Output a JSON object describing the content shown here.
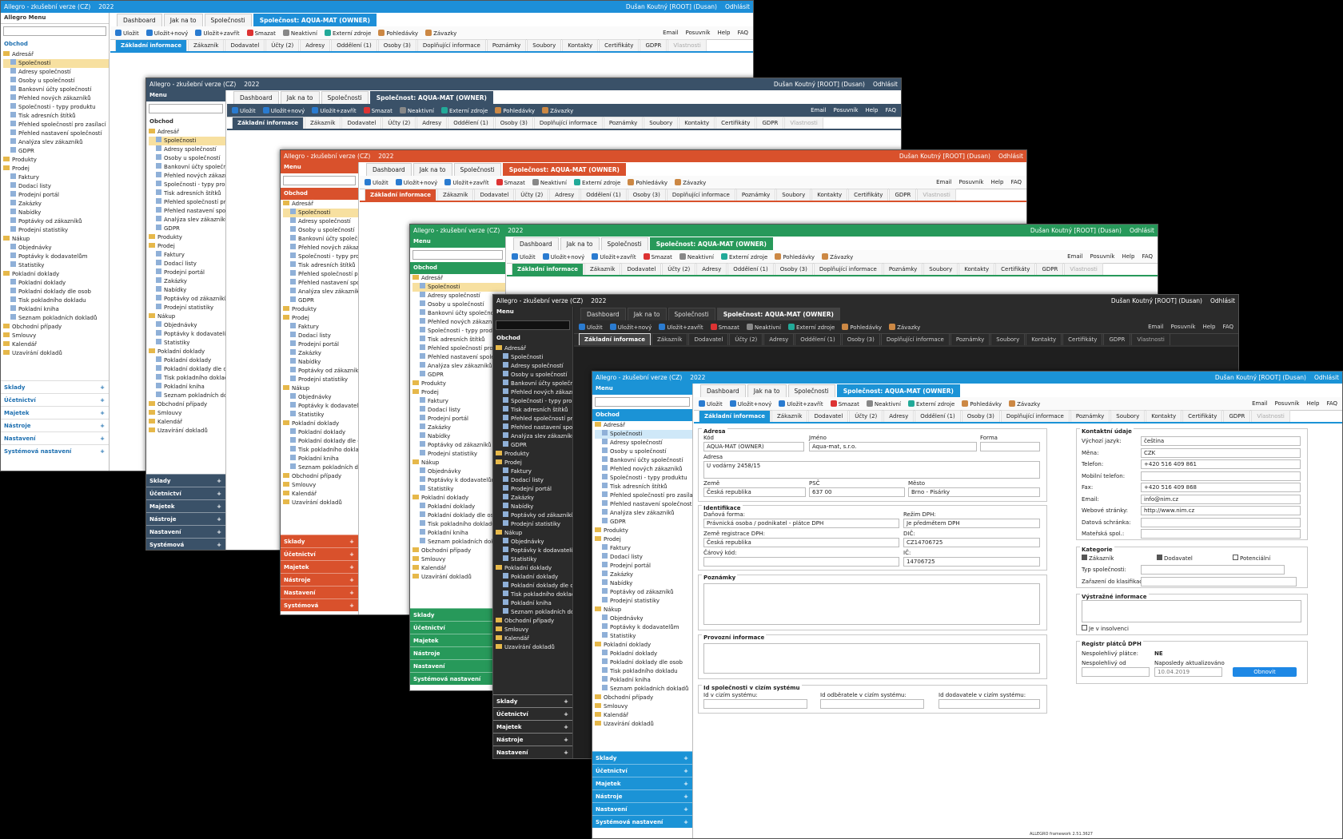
{
  "common": {
    "user": "Dušan Koutný [ROOT] (Dusan)",
    "logout": "Odhlásit",
    "year": "2022",
    "env": "Allegro - zkušební verze (CZ)",
    "menu": "Menu",
    "tabs": [
      "Dashboard",
      "Jak na to",
      "Společnosti",
      "Společnost: AQUA-MAT (OWNER)"
    ],
    "toolbar": [
      "Uložit",
      "Uložit+nový",
      "Uložit+zavřít",
      "Smazat",
      "Neaktivní",
      "Externí zdroje",
      "Pohledávky",
      "Závazky"
    ],
    "toolbar_right": [
      "Email",
      "Posuvník",
      "Help",
      "FAQ"
    ],
    "subtabs": [
      "Základní informace",
      "Zákazník",
      "Dodavatel",
      "Účty (2)",
      "Adresy",
      "Oddělení (1)",
      "Osoby (3)",
      "Doplňující informace",
      "Poznámky",
      "Soubory",
      "Kontakty",
      "Certifikáty",
      "GDPR",
      "Vlastnosti"
    ],
    "section_obchod": "Obchod",
    "tree": [
      "Adresář",
      "Společnosti",
      "Adresy společností",
      "Osoby u společností",
      "Bankovní účty společností",
      "Přehled nových zákazníků",
      "Společnosti - typy produktu",
      "Tisk adresních štítků",
      "Přehled společností pro zasílací",
      "Přehled nastavení společností",
      "Analýza slev zákazníků",
      "GDPR",
      "Produkty",
      "Prodej",
      "Faktury",
      "Dodací listy",
      "Prodejní portál",
      "Zakázky",
      "Nabídky",
      "Poptávky od zákazníků",
      "Prodejní statistiky",
      "Nákup",
      "Objednávky",
      "Poptávky k dodavatelům",
      "Statistiky",
      "Pokladní doklady",
      "Pokladní doklady",
      "Pokladní doklady dle osob",
      "Tisk pokladního dokladu",
      "Pokladní kniha",
      "Seznam pokladních dokladů",
      "Obchodní případy",
      "Smlouvy",
      "Kalendář",
      "Uzavírání dokladů"
    ],
    "bottom_sections": [
      "Sklady",
      "Účetnictví",
      "Majetek",
      "Nástroje",
      "Nastavení",
      "Systémová nastavení"
    ],
    "title_small": "Allegro Menu"
  },
  "form": {
    "adresa": "Adresa",
    "kod_label": "Kód",
    "kod": "AQUA-MAT (OWNER)",
    "jmeno_label": "Jméno",
    "jmeno": "Aqua-mat, s.r.o.",
    "forma_label": "Forma",
    "adresa_label": "Adresa",
    "ulice": "U vodárny 2458/15",
    "zeme_label": "Země",
    "zeme": "Česká republika",
    "psc_label": "PSČ",
    "psc": "637 00",
    "mesto_label": "Město",
    "mesto": "Brno - Pisárky",
    "identifikace": "Identifikace",
    "danova_forma_label": "Daňová forma:",
    "danova_forma": "Právnická osoba / podnikatel - plátce DPH",
    "rezim_label": "Režim DPH:",
    "rezim": "Je předmětem DPH",
    "zeme_reg_label": "Země registrace DPH:",
    "zeme_reg": "Česká republika",
    "dic_label": "DIČ:",
    "dic": "CZ14706725",
    "carovy_label": "Čárový kód:",
    "ic_label": "IČ:",
    "ic": "14706725",
    "poznamky": "Poznámky",
    "provozni": "Provozní informace",
    "id_ciz": "Id společnosti v cizím systému",
    "id_ciz_sys": "Id v cizím systému:",
    "id_odb": "Id odběratele v cizím systému:",
    "id_dod": "Id dodavatele v cizím systému:",
    "kontakt": "Kontaktní údaje",
    "jazyk_label": "Výchozí jazyk:",
    "jazyk": "čeština",
    "mena_label": "Měna:",
    "mena": "CZK",
    "tel_label": "Telefon:",
    "tel": "+420 516 409 861",
    "mob_label": "Mobilní telefon:",
    "fax_label": "Fax:",
    "fax": "+420 516 409 868",
    "email_label": "Email:",
    "email": "info@nim.cz",
    "web_label": "Webové stránky:",
    "web": "http://www.nim.cz",
    "datschr_label": "Datová schránka:",
    "matersk_label": "Mateřská spol.:",
    "kategorie": "Kategorie",
    "zakaznik": "Zákazník",
    "dodavatel": "Dodavatel",
    "potencialni": "Potenciální",
    "typ_label": "Typ společnosti:",
    "zarazeni_label": "Zařazení do klasifikace:",
    "vystrazne": "Výstražné informace",
    "je_v_insolv": "Je v insolvenci",
    "registr": "Registr plátců DPH",
    "nespol_label": "Nespolehlivý plátce:",
    "nespol": "NE",
    "nespol_od_label": "Nespolehlivý od",
    "naposledy_label": "Naposledy aktualizováno",
    "naposledy": "10.04.2019",
    "obnovit": "Obnovit"
  },
  "footer": "ALLEGRO framework 2.51.3627",
  "theme": {
    "blue": "#1d8fd8",
    "navy": "#3a5168",
    "orange": "#d9512c",
    "green": "#27995a",
    "dark": "#2b2b2b",
    "blue2": "#1b93d6"
  }
}
